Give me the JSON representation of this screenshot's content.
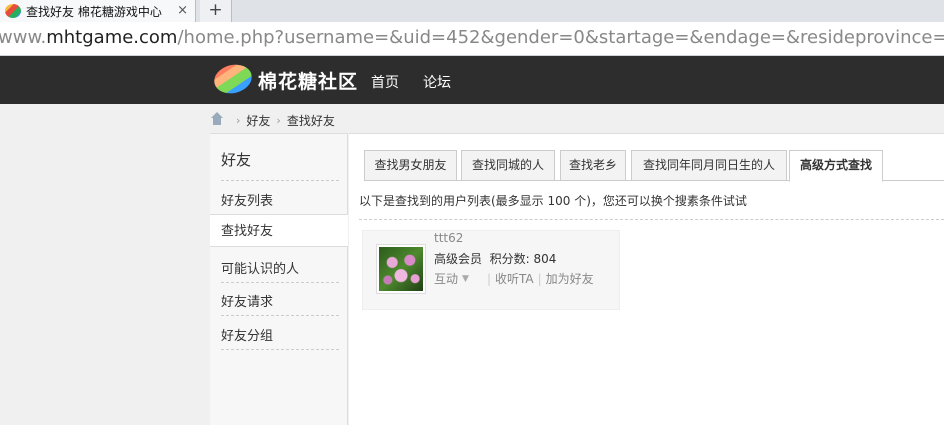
{
  "browser": {
    "tab_title": "查找好友 棉花糖游戏中心",
    "close_glyph": "×",
    "newtab_glyph": "+",
    "url_prefix": "www.",
    "url_host": "mhtgame.com",
    "url_path": "/home.php?username=&uid=452&gender=0&startage=&endage=&resideprovince=&birthprovince=&birthy"
  },
  "site": {
    "logo": "棉花糖社区",
    "nav": [
      "首页",
      "论坛"
    ]
  },
  "breadcrumb": [
    "好友",
    "查找好友"
  ],
  "sidebar": {
    "title": "好友",
    "items": [
      "好友列表",
      "查找好友",
      "可能认识的人",
      "好友请求",
      "好友分组"
    ],
    "active_index": 1
  },
  "main": {
    "tabs": [
      "查找男女朋友",
      "查找同城的人",
      "查找老乡",
      "查找同年同月同日生的人",
      "高级方式查找"
    ],
    "active_tab": 4,
    "result_note": "以下是查找到的用户列表(最多显示 100 个)，您还可以换个搜素条件试试",
    "user": {
      "name": "ttt62",
      "group": "高级会员",
      "points_label": "积分数:",
      "points": "804",
      "action_interact": "互动",
      "action_follow": "收听TA",
      "action_add": "加为好友"
    }
  },
  "colors": {
    "header_bg": "#2d2d2d",
    "sidebar_bg": "#f7f7f7"
  },
  "icons": [
    "favicon-icon",
    "home-icon",
    "logo-icon",
    "caret-down-icon"
  ]
}
